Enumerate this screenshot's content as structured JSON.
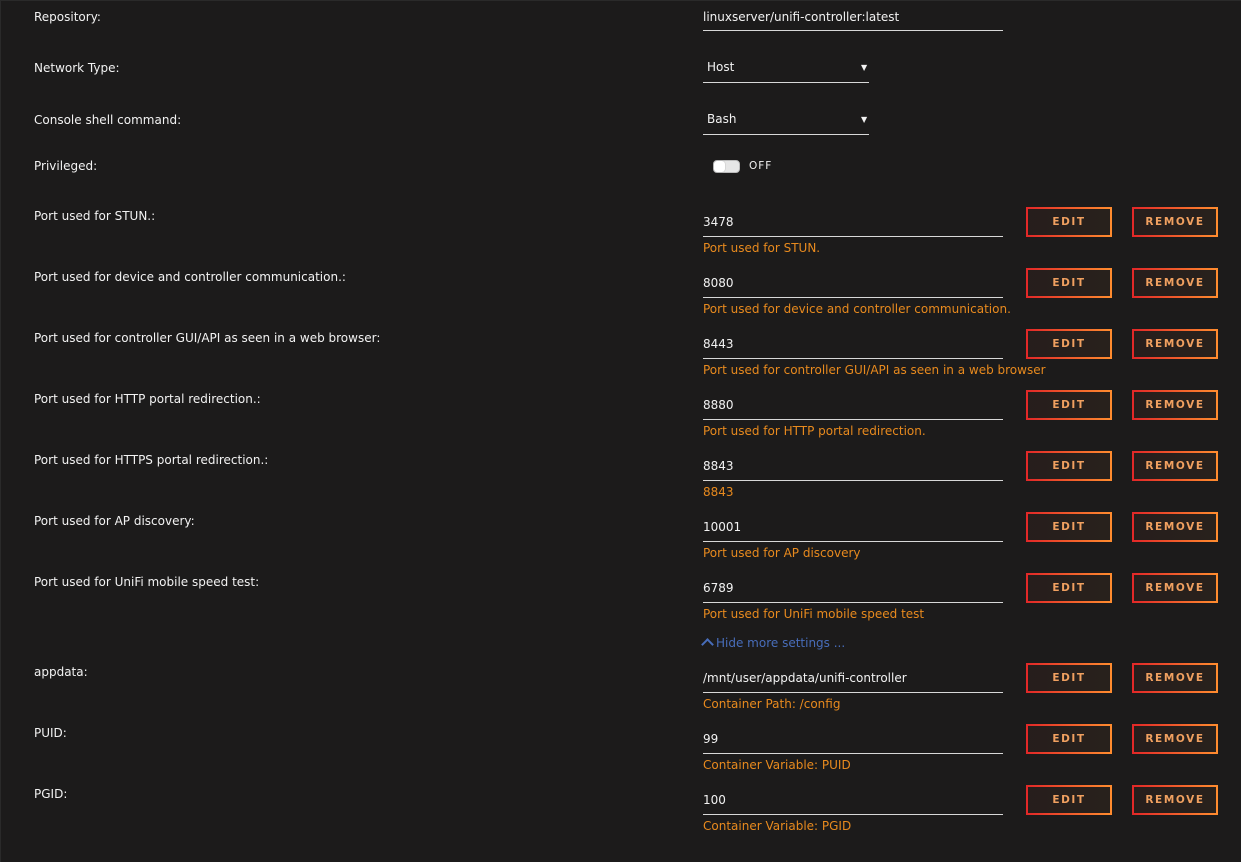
{
  "repository": {
    "label": "Repository:",
    "value": "linuxserver/unifi-controller:latest"
  },
  "network_type": {
    "label": "Network Type:",
    "value": "Host"
  },
  "console_shell": {
    "label": "Console shell command:",
    "value": "Bash"
  },
  "privileged": {
    "label": "Privileged:",
    "state": "OFF"
  },
  "buttons": {
    "edit": "EDIT",
    "remove": "REMOVE"
  },
  "ports": [
    {
      "label": "Port used for STUN.:",
      "value": "3478",
      "hint": "Port used for STUN."
    },
    {
      "label": "Port used for device and controller communication.:",
      "value": "8080",
      "hint": "Port used for device and controller communication."
    },
    {
      "label": "Port used for controller GUI/API as seen in a web browser:",
      "value": "8443",
      "hint": "Port used for controller GUI/API as seen in a web browser"
    },
    {
      "label": "Port used for HTTP portal redirection.:",
      "value": "8880",
      "hint": "Port used for HTTP portal redirection."
    },
    {
      "label": "Port used for HTTPS portal redirection.:",
      "value": "8843",
      "hint": "8843"
    },
    {
      "label": "Port used for AP discovery:",
      "value": "10001",
      "hint": "Port used for AP discovery"
    },
    {
      "label": "Port used for UniFi mobile speed test:",
      "value": "6789",
      "hint": "Port used for UniFi mobile speed test"
    }
  ],
  "hide_link": "Hide more settings ...",
  "extra": [
    {
      "label": "appdata:",
      "value": "/mnt/user/appdata/unifi-controller",
      "hint": "Container Path: /config"
    },
    {
      "label": "PUID:",
      "value": "99",
      "hint": "Container Variable: PUID"
    },
    {
      "label": "PGID:",
      "value": "100",
      "hint": "Container Variable: PGID"
    }
  ],
  "colors": {
    "background": "#1c1b1b",
    "hint": "#e88a1e",
    "link": "#486dba",
    "button_border_start": "#e22828",
    "button_border_end": "#ff8c2f"
  }
}
